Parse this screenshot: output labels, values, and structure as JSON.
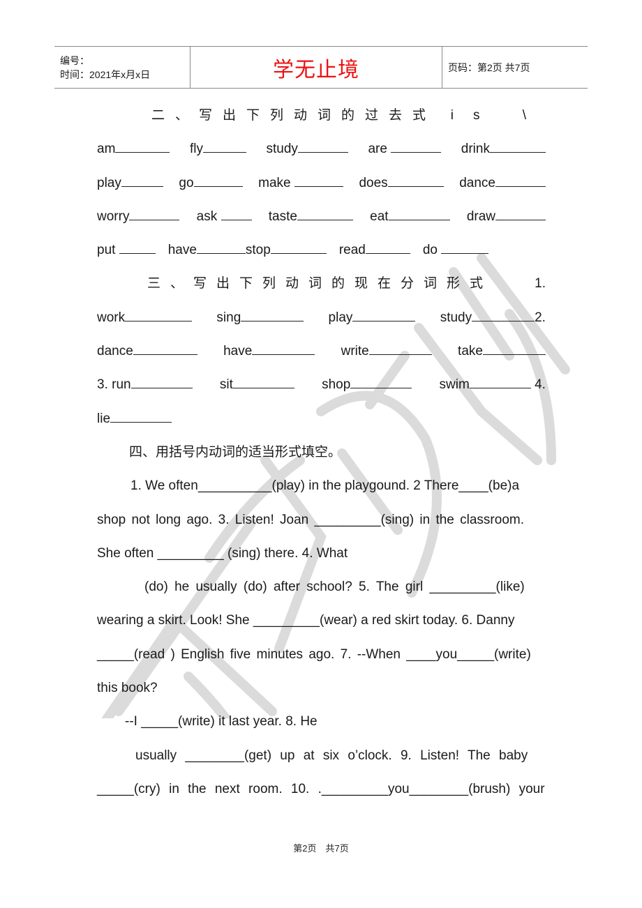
{
  "header": {
    "number_label": "编号：",
    "time_label": "时间：2021年x月x日",
    "title": "学无止境",
    "page_label": "页码：第2页 共7页",
    "title_color": "#ee1111"
  },
  "section2": {
    "title": "二、写出下列动词的过去式",
    "trail": "is \\",
    "rows": [
      [
        "am",
        "fly",
        "study",
        "are",
        "drink"
      ],
      [
        "play",
        "go",
        "make",
        "does",
        "dance"
      ],
      [
        "worry",
        "ask",
        "taste",
        "eat",
        "draw"
      ],
      [
        "put",
        "have",
        "stop",
        "read",
        "do"
      ]
    ]
  },
  "section3": {
    "title": "三、写出下列动词的现在分词形式",
    "trail": "1.",
    "row1": [
      "work",
      "sing",
      "play",
      "study"
    ],
    "row1_trail": "2.",
    "row2": [
      "dance",
      "have",
      "write",
      "take"
    ],
    "row3_prefix": "3. run",
    "row3": [
      "sit",
      "shop",
      "swim"
    ],
    "row3_trail": "4.",
    "row4": "lie"
  },
  "section4": {
    "title": "四、用括号内动词的适当形式填空。",
    "lines": [
      "1. We often__________(play) in the playgound. 2 There____(be)a",
      "shop not long ago. 3. Listen! Joan _________(sing) in the classroom.",
      "She often _________ (sing) there. 4. What",
      "(do) he usually (do) after school? 5. The girl _________(like)",
      "wearing a skirt. Look! She _________(wear) a red skirt today. 6. Danny",
      "_____(read ) English five minutes ago. 7. --When ____you_____(write)",
      "this book?",
      "--I _____(write) it last year. 8. He",
      "usually ________(get) up at six o’clock. 9. Listen! The baby",
      "_____(cry) in the next room. 10. ._________you________(brush) your"
    ]
  },
  "footer": {
    "page_text": "第2页　共7页"
  },
  "watermark": {
    "text": "严禁复制"
  }
}
